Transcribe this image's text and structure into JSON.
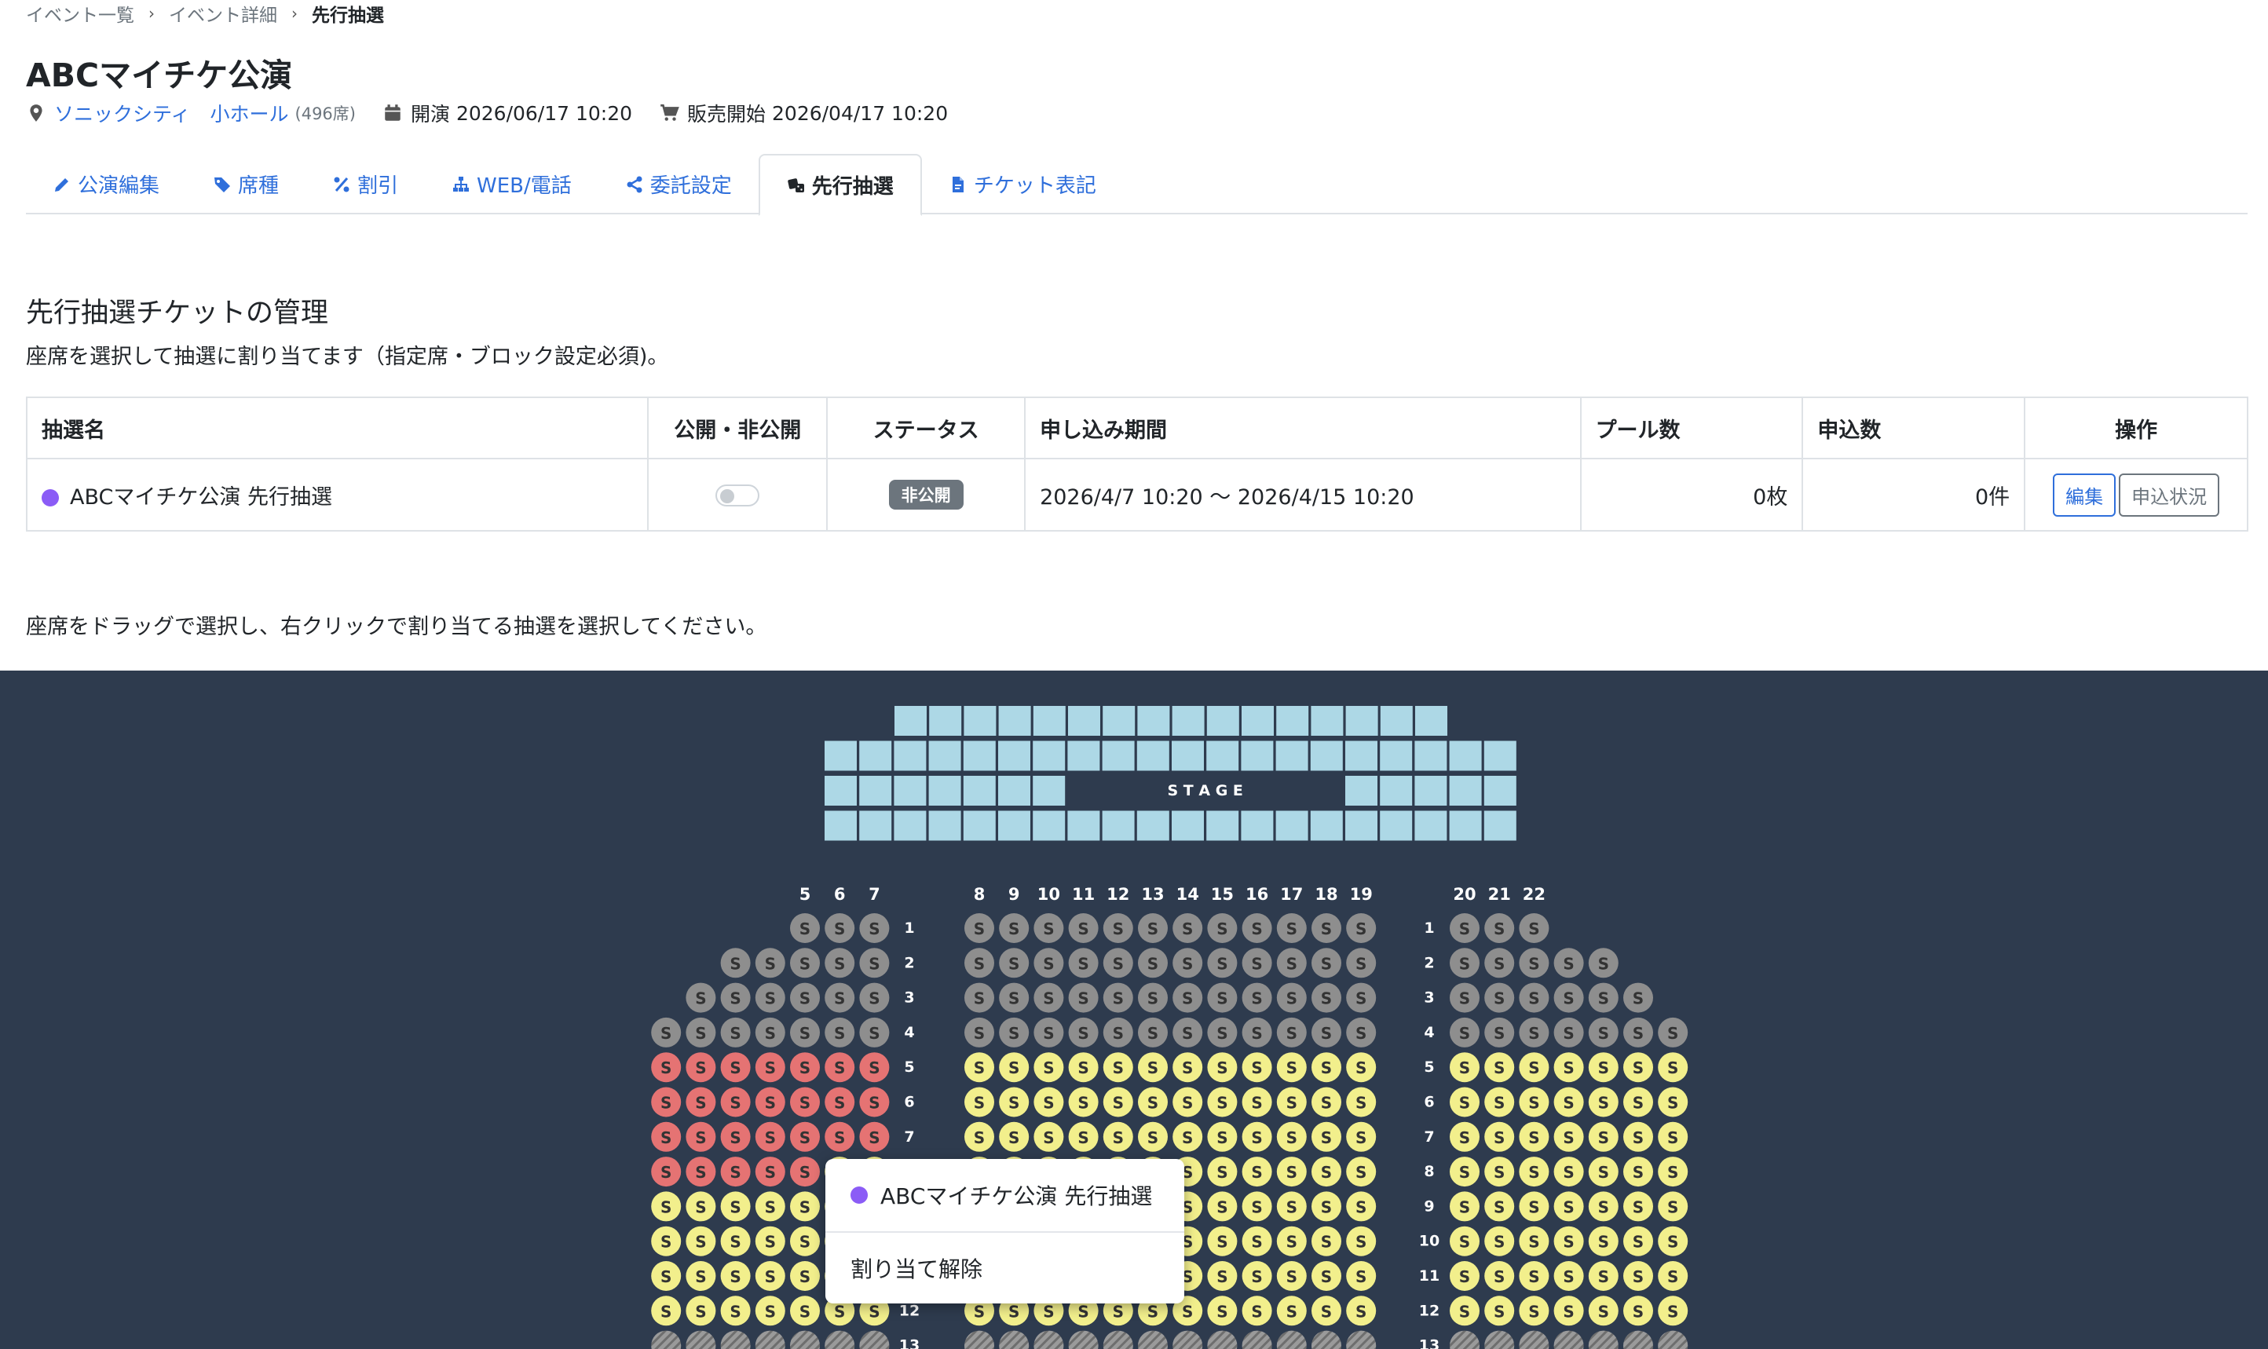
{
  "breadcrumb": {
    "items": [
      "イベント一覧",
      "イベント詳細"
    ],
    "current": "先行抽選"
  },
  "title": "ABCマイチケ公演",
  "meta": {
    "venue": "ソニックシティ　小ホール",
    "capacity": "(496席)",
    "show_label": "開演",
    "show_date": "2026/06/17 10:20",
    "sale_label": "販売開始",
    "sale_date": "2026/04/17 10:20"
  },
  "tabs": [
    {
      "label": "公演編集",
      "icon": "pencil-icon"
    },
    {
      "label": "席種",
      "icon": "tags-icon"
    },
    {
      "label": "割引",
      "icon": "percent-icon"
    },
    {
      "label": "WEB/電話",
      "icon": "sitemap-icon"
    },
    {
      "label": "委託設定",
      "icon": "share-icon"
    },
    {
      "label": "先行抽選",
      "icon": "dice-icon",
      "active": true
    },
    {
      "label": "チケット表記",
      "icon": "file-icon"
    }
  ],
  "section": {
    "title": "先行抽選チケットの管理",
    "description": "座席を選択して抽選に割り当てます（指定席・ブロック設定必須)。"
  },
  "table": {
    "headers": [
      "抽選名",
      "公開・非公開",
      "ステータス",
      "申し込み期間",
      "プール数",
      "申込数",
      "操作"
    ],
    "rows": [
      {
        "name": "ABCマイチケ公演 先行抽選",
        "status": "非公開",
        "period": "2026/4/7 10:20 〜 2026/4/15 10:20",
        "pool": "0枚",
        "applications": "0件",
        "edit_label": "編集",
        "status_button_label": "申込状況"
      }
    ]
  },
  "instruction": "座席をドラッグで選択し、右クリックで割り当てる抽選を選択してください。",
  "seatmap": {
    "stage_label": "S T A G E",
    "seat_label": "S",
    "left_columns": [
      "5",
      "6",
      "7"
    ],
    "center_columns": [
      "8",
      "9",
      "10",
      "11",
      "12",
      "13",
      "14",
      "15",
      "16",
      "17",
      "18",
      "19"
    ],
    "right_columns": [
      "20",
      "21",
      "22"
    ],
    "row_labels": [
      "1",
      "2",
      "3",
      "4",
      "5",
      "6",
      "7",
      "8",
      "9",
      "10",
      "11",
      "12",
      "13"
    ]
  },
  "context_menu": {
    "items": [
      {
        "label": "ABCマイチケ公演 先行抽選"
      },
      {
        "label": "割り当て解除"
      }
    ]
  },
  "colors": {
    "lottery": "#8b5cf6",
    "link": "#2f6fdb",
    "map_bg": "#2e3b4e",
    "stage_tile": "#add8e6",
    "seat_gray": "#8e8e8e",
    "seat_red": "#e57373",
    "seat_yellow": "#f2ef8c"
  }
}
